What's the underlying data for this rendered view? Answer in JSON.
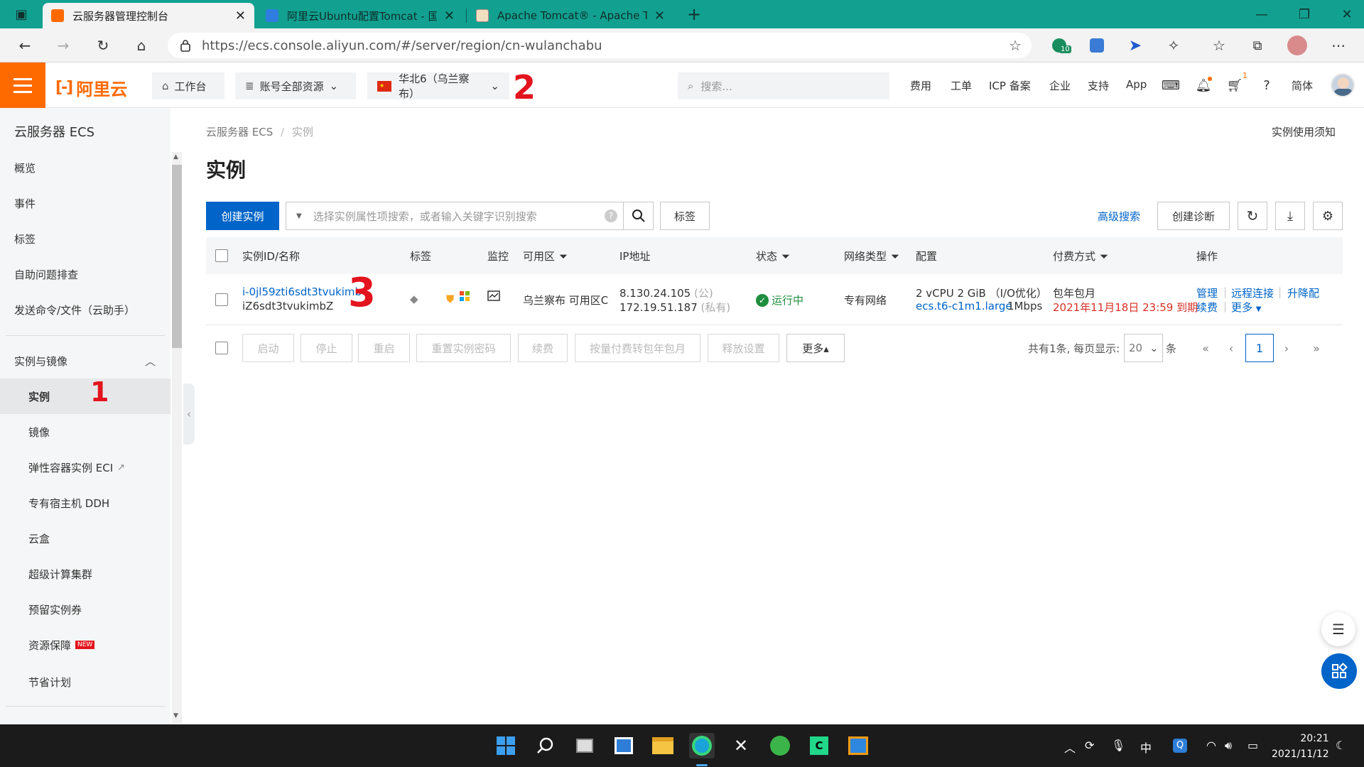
{
  "browser": {
    "tabs": [
      {
        "title": "云服务器管理控制台",
        "active": true
      },
      {
        "title": "阿里云Ubuntu配置Tomcat - 国内",
        "active": false
      },
      {
        "title": "Apache Tomcat® - Apache Tomc",
        "active": false
      }
    ],
    "url": "https://ecs.console.aliyun.com/#/server/region/cn-wulanchabu",
    "ext_badge": "10"
  },
  "topnav": {
    "logo": "阿里云",
    "workbench": "工作台",
    "account_resources": "账号全部资源",
    "region": "华北6（乌兰察布）",
    "search_placeholder": "搜索...",
    "links": [
      "费用",
      "工单",
      "ICP 备案",
      "企业",
      "支持",
      "App"
    ],
    "cart_badge": "1",
    "lang": "简体"
  },
  "sidebar": {
    "title": "云服务器 ECS",
    "items": [
      "概览",
      "事件",
      "标签",
      "自助问题排查",
      "发送命令/文件（云助手）"
    ],
    "group": "实例与镜像",
    "sub_items": [
      "实例",
      "镜像",
      "弹性容器实例 ECI",
      "专有宿主机 DDH",
      "云盒",
      "超级计算集群",
      "预留实例券",
      "资源保障",
      "节省计划"
    ],
    "new_badge": "NEW"
  },
  "main": {
    "breadcrumb_root": "云服务器 ECS",
    "breadcrumb_sep": "/",
    "breadcrumb_current": "实例",
    "notice": "实例使用须知",
    "title": "实例",
    "create_button": "创建实例",
    "search_placeholder": "选择实例属性项搜索，或者输入关键字识别搜索",
    "tag_button": "标签",
    "advanced_search": "高级搜索",
    "diagnose_button": "创建诊断"
  },
  "table": {
    "headers": [
      "实例ID/名称",
      "标签",
      "监控",
      "可用区",
      "IP地址",
      "状态",
      "网络类型",
      "配置",
      "付费方式",
      "操作"
    ],
    "row": {
      "id": "i-0jl59zti6sdt3tvukimb",
      "name": "iZ6sdt3tvukimbZ",
      "zone": "乌兰察布 可用区C",
      "ip_public": "8.130.24.105",
      "ip_public_tag": "(公)",
      "ip_private": "172.19.51.187",
      "ip_private_tag": "(私有)",
      "status": "运行中",
      "network": "专有网络",
      "config_line1": "2 vCPU 2 GiB （I/O优化）",
      "instance_type": "ecs.t6-c1m1.large",
      "bandwidth": "1Mbps",
      "billing": "包年包月",
      "expiry": "2021年11月18日 23:59 到期",
      "ops": [
        "管理",
        "远程连接",
        "升降配",
        "续费",
        "更多"
      ]
    }
  },
  "actions": [
    "启动",
    "停止",
    "重启",
    "重置实例密码",
    "续费",
    "按量付费转包年包月",
    "释放设置",
    "更多▴"
  ],
  "pagination": {
    "info": "共有1条, 每页显示:",
    "size": "20",
    "unit": "条",
    "current": "1"
  },
  "annotations": [
    "1",
    "2",
    "3"
  ],
  "taskbar": {
    "ime": "中",
    "time": "20:21",
    "date": "2021/11/12"
  },
  "colors": {
    "tabbar": "#12a090",
    "brand": "#ff6a00",
    "primary": "#0064c8",
    "success": "#1e8e3e",
    "danger": "#d93026"
  }
}
